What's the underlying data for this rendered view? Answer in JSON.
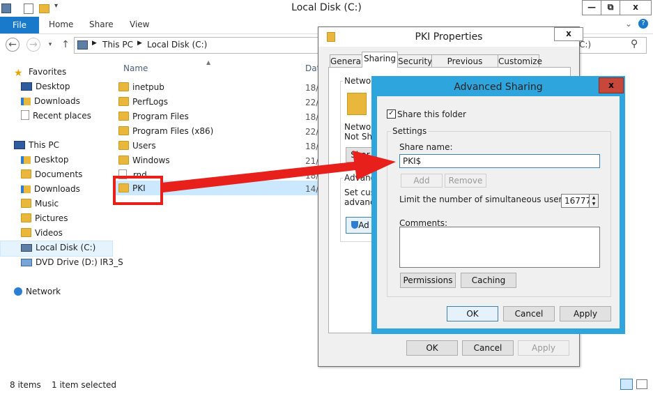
{
  "window": {
    "title": "Local Disk (C:)",
    "controls": {
      "minimize": "—",
      "maximize": "⧉",
      "close": "x"
    }
  },
  "ribbon": {
    "tabs": [
      "File",
      "Home",
      "Share",
      "View"
    ]
  },
  "address_bar": {
    "crumbs": [
      "This PC",
      "Local Disk (C:)"
    ],
    "search_fragment": "C:)"
  },
  "nav": {
    "favorites_label": "Favorites",
    "favorites": [
      "Desktop",
      "Downloads",
      "Recent places"
    ],
    "this_pc_label": "This PC",
    "this_pc": [
      "Desktop",
      "Documents",
      "Downloads",
      "Music",
      "Pictures",
      "Videos",
      "Local Disk (C:)",
      "DVD Drive (D:) IR3_S"
    ],
    "network_label": "Network"
  },
  "file_list": {
    "column_name": "Name",
    "column_date": "Dat",
    "rows": [
      {
        "name": "inetpub",
        "date": "18/"
      },
      {
        "name": "PerfLogs",
        "date": "22/"
      },
      {
        "name": "Program Files",
        "date": "18/"
      },
      {
        "name": "Program Files (x86)",
        "date": "22/"
      },
      {
        "name": "Users",
        "date": "18/"
      },
      {
        "name": "Windows",
        "date": "21/"
      },
      {
        "name": ".rnd",
        "date": "18/"
      },
      {
        "name": "PKI",
        "date": "14/"
      }
    ]
  },
  "status": {
    "items": "8 items",
    "selected": "1 item selected"
  },
  "pki_properties": {
    "title": "PKI Properties",
    "close": "x",
    "tabs": [
      "General",
      "Sharing",
      "Security",
      "Previous Versions",
      "Customize"
    ],
    "network_heading": "Network",
    "network_line1": "Network",
    "network_line2": "Not Sha",
    "share_button": "Shar",
    "advanced_heading": "Advance",
    "advanced_line1": "Set cust",
    "advanced_line2": "advance",
    "advanced_button": "Ad",
    "ok": "OK",
    "cancel": "Cancel",
    "apply": "Apply"
  },
  "advanced_sharing": {
    "title": "Advanced Sharing",
    "close": "x",
    "share_checkbox_label": "Share this folder",
    "share_checked": true,
    "settings_label": "Settings",
    "share_name_label": "Share name:",
    "share_name_value": "PKI$",
    "add": "Add",
    "remove": "Remove",
    "limit_label": "Limit the number of simultaneous users to:",
    "limit_value": "16777",
    "comments_label": "Comments:",
    "permissions": "Permissions",
    "caching": "Caching",
    "ok": "OK",
    "cancel": "Cancel",
    "apply": "Apply"
  },
  "annotation": {
    "highlight_color": "#e8201c"
  }
}
